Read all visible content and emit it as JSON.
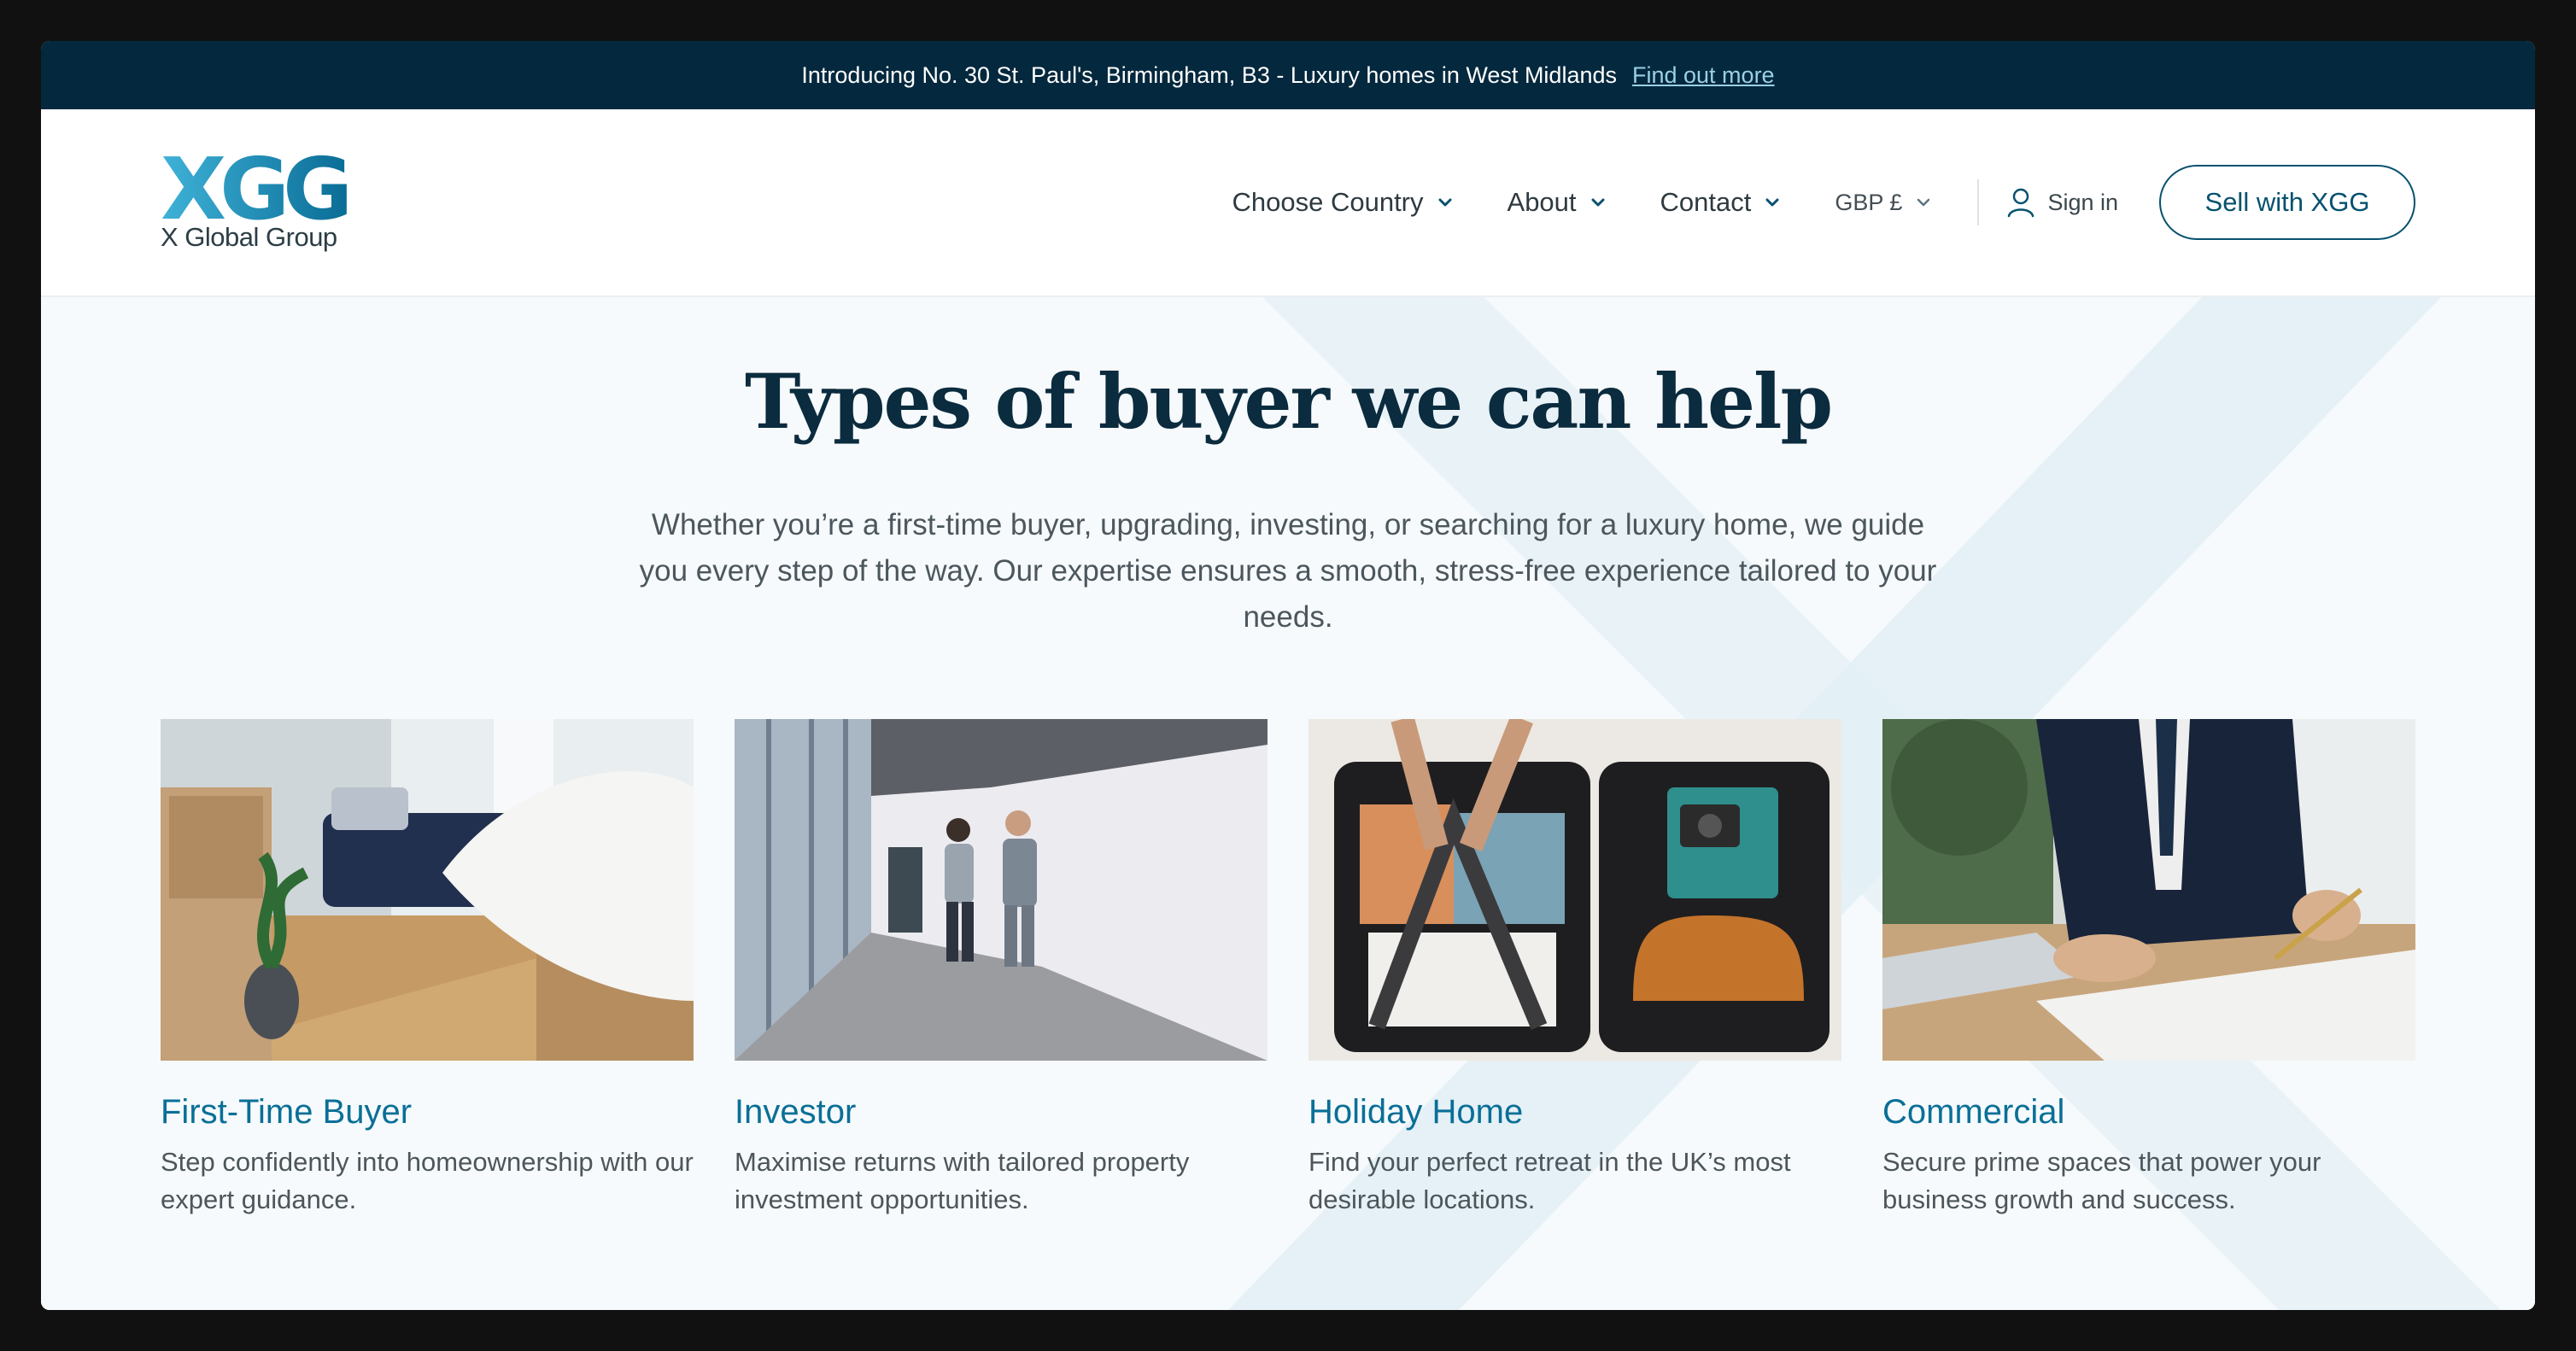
{
  "announcement": {
    "text": "Introducing No. 30 St. Paul's, Birmingham, B3 - Luxury homes in West Midlands",
    "link": "Find out more"
  },
  "brand": {
    "mark": "XGG",
    "name": "X Global Group"
  },
  "nav": {
    "items": [
      {
        "label": "Choose Country"
      },
      {
        "label": "About"
      },
      {
        "label": "Contact"
      },
      {
        "label": "GBP £"
      }
    ],
    "signin": "Sign in",
    "cta": "Sell with XGG"
  },
  "hero": {
    "title": "Types of buyer we can help",
    "lead": "Whether you’re a first-time buyer, upgrading, investing, or searching for a luxury home, we guide you every step of the way. Our expertise ensures a smooth, stress-free experience tailored to your needs."
  },
  "cards": [
    {
      "title": "First-Time Buyer",
      "text": "Step confidently into homeownership with our expert guidance.",
      "icon": "living-room-photo"
    },
    {
      "title": "Investor",
      "text": "Maximise returns with tailored property investment opportunities.",
      "icon": "office-corridor-photo"
    },
    {
      "title": "Holiday Home",
      "text": "Find your perfect retreat in the UK’s most desirable locations.",
      "icon": "suitcase-packing-photo"
    },
    {
      "title": "Commercial",
      "text": "Secure prime spaces that power your business growth and success.",
      "icon": "signing-document-photo"
    }
  ],
  "colors": {
    "announcement_bg": "#04283d",
    "accent": "#0a6f97",
    "cta_border": "#06516f",
    "section_bg": "#f6fafc"
  }
}
